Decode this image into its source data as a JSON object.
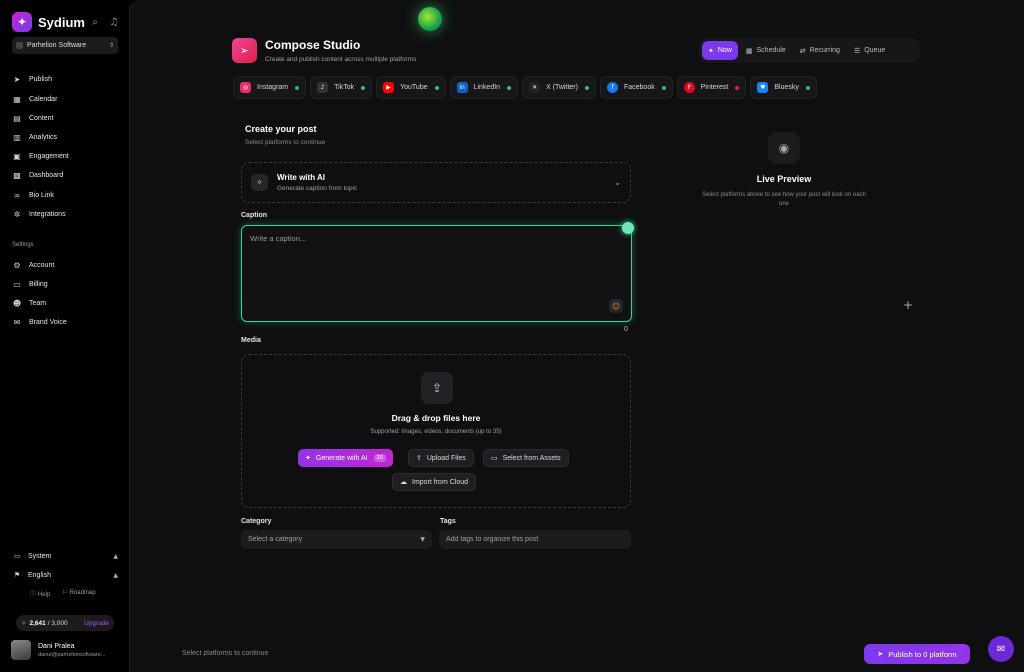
{
  "brand": {
    "name": "Sydium"
  },
  "org": {
    "name": "Parhelion Software"
  },
  "nav": {
    "items": [
      {
        "label": "Publish",
        "icon": "send-icon"
      },
      {
        "label": "Calendar",
        "icon": "calendar-icon"
      },
      {
        "label": "Content",
        "icon": "content-icon"
      },
      {
        "label": "Analytics",
        "icon": "analytics-icon"
      },
      {
        "label": "Engagement",
        "icon": "engagement-icon"
      },
      {
        "label": "Dashboard",
        "icon": "dashboard-icon"
      },
      {
        "label": "Bio Link",
        "icon": "link-icon"
      },
      {
        "label": "Integrations",
        "icon": "integrations-icon"
      }
    ],
    "settings_label": "Settings",
    "settings": [
      {
        "label": "Account",
        "icon": "account-icon"
      },
      {
        "label": "Billing",
        "icon": "billing-icon"
      },
      {
        "label": "Team",
        "icon": "team-icon"
      },
      {
        "label": "Brand Voice",
        "icon": "brand-voice-icon"
      }
    ]
  },
  "sidebar_bottom": {
    "system": "System",
    "language": "English",
    "help": "Help",
    "roadmap": "Roadmap",
    "credits_used": "2,641",
    "credits_total": "/ 3,000",
    "upgrade": "Upgrade"
  },
  "user": {
    "name": "Dani Pralea",
    "email": "danut@parhelionsoftware..."
  },
  "header": {
    "title": "Compose Studio",
    "subtitle": "Create and publish content across multiple platforms",
    "modes": [
      "Now",
      "Schedule",
      "Recurring",
      "Queue"
    ]
  },
  "platforms": [
    {
      "name": "Instagram",
      "status_color": "#22c55e",
      "brand_color": "#e1306c"
    },
    {
      "name": "TikTok",
      "status_color": "#22c55e",
      "brand_color": "#333333"
    },
    {
      "name": "YouTube",
      "status_color": "#22c55e",
      "brand_color": "#ff0000"
    },
    {
      "name": "LinkedIn",
      "status_color": "#22c55e",
      "brand_color": "#0a66c2"
    },
    {
      "name": "X (Twitter)",
      "status_color": "#22c55e",
      "brand_color": "#222222"
    },
    {
      "name": "Facebook",
      "status_color": "#22c55e",
      "brand_color": "#1877f2"
    },
    {
      "name": "Pinterest",
      "status_color": "#e11d48",
      "brand_color": "#e60023"
    },
    {
      "name": "Bluesky",
      "status_color": "#22c55e",
      "brand_color": "#1185fe"
    }
  ],
  "compose": {
    "title": "Create your post",
    "subtitle": "Select platforms to continue",
    "ai_title": "Write with AI",
    "ai_subtitle": "Generate caption from topic",
    "caption_label": "Caption",
    "caption_placeholder": "Write a caption...",
    "caption_count": "0",
    "media_label": "Media",
    "drag_text": "Drag & drop files here",
    "supported_text": "Supported: images, videos, documents (up to 35)",
    "generate_ai": "Generate with AI",
    "generate_badge": "20",
    "upload_files": "Upload Files",
    "select_assets": "Select from Assets",
    "import_cloud": "Import from Cloud",
    "category_label": "Category",
    "category_placeholder": "Select a category",
    "tags_label": "Tags",
    "tags_placeholder": "Add tags to organize this post"
  },
  "preview": {
    "title": "Live Preview",
    "subtitle": "Select platforms above to see how your post will look on each one"
  },
  "footer": {
    "hint": "Select platforms to continue",
    "publish": "Publish to 0 platform"
  }
}
